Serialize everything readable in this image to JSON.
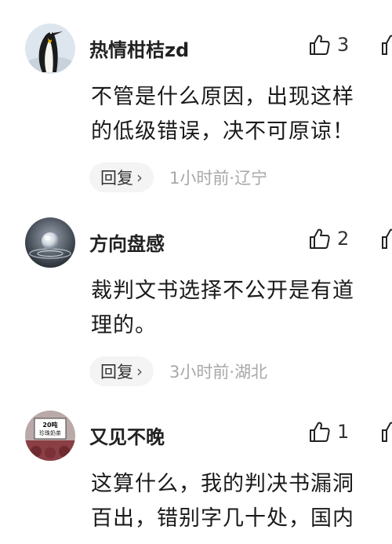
{
  "comments": [
    {
      "username": "热情柑桔zd",
      "likes": "3",
      "content_lines": [
        "不管是什么原因，出现这样",
        "的低级错误，决不可原谅！"
      ],
      "reply_label": "回复",
      "reply_chevron": "›",
      "time": "1小时前",
      "separator": "·",
      "location": "辽宁",
      "avatar_icon": "penguin-avatar"
    },
    {
      "username": "方向盘感",
      "likes": "2",
      "content_lines": [
        "裁判文书选择不公开是有道",
        "理的。"
      ],
      "reply_label": "回复",
      "reply_chevron": "›",
      "time": "3小时前",
      "separator": "·",
      "location": "湖北",
      "avatar_icon": "water-drop-avatar"
    },
    {
      "username": "又见不晚",
      "likes": "1",
      "content_lines": [
        "这算什么，我的判决书漏洞",
        "百出，错别字几十处，国内"
      ],
      "avatar_icon": "sign-avatar",
      "avatar_text": [
        "20吨",
        "珍珠奶茶"
      ]
    }
  ],
  "icons": {
    "like": "thumbs-up-icon",
    "more": "more-icon"
  }
}
